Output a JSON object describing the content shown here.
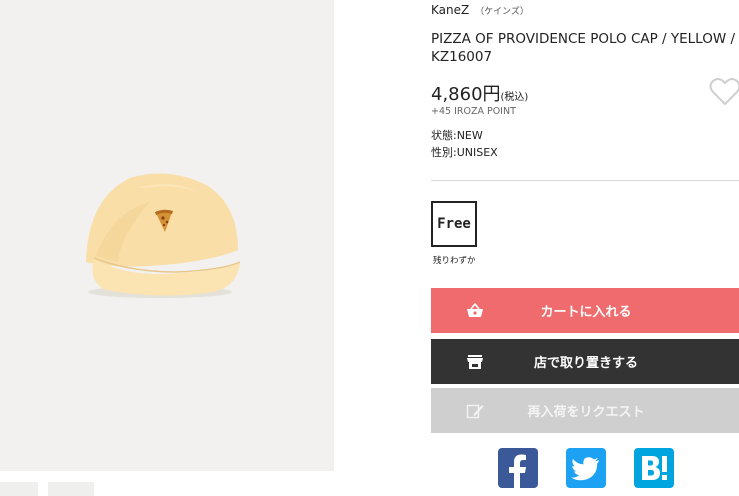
{
  "brand": {
    "name": "KaneZ",
    "kana": "（ケインズ）"
  },
  "product": {
    "title": "PIZZA OF PROVIDENCE POLO CAP / YELLOW / KZ16007",
    "price": "4,860円",
    "tax_label": "(税込)",
    "points": "+45 IROZA POINT",
    "status": "状態:NEW",
    "gender": "性別:UNISEX"
  },
  "size": {
    "label": "Free",
    "stock_note": "残りわずか"
  },
  "buttons": {
    "cart": "カートに入れる",
    "store": "店で取り置きする",
    "request": "再入荷をリクエスト"
  },
  "icons": {
    "favorite": "heart-icon",
    "cart": "basket-icon",
    "store": "store-icon",
    "request": "edit-icon",
    "facebook": "facebook-icon",
    "twitter": "twitter-icon",
    "hatena": "hatena-bookmark-icon"
  },
  "colors": {
    "cart_button": "#f06b6d",
    "store_button": "#333333",
    "request_button": "#cfcfcf",
    "facebook": "#3b5998",
    "twitter": "#1da1f2",
    "hatena": "#00a4de"
  }
}
